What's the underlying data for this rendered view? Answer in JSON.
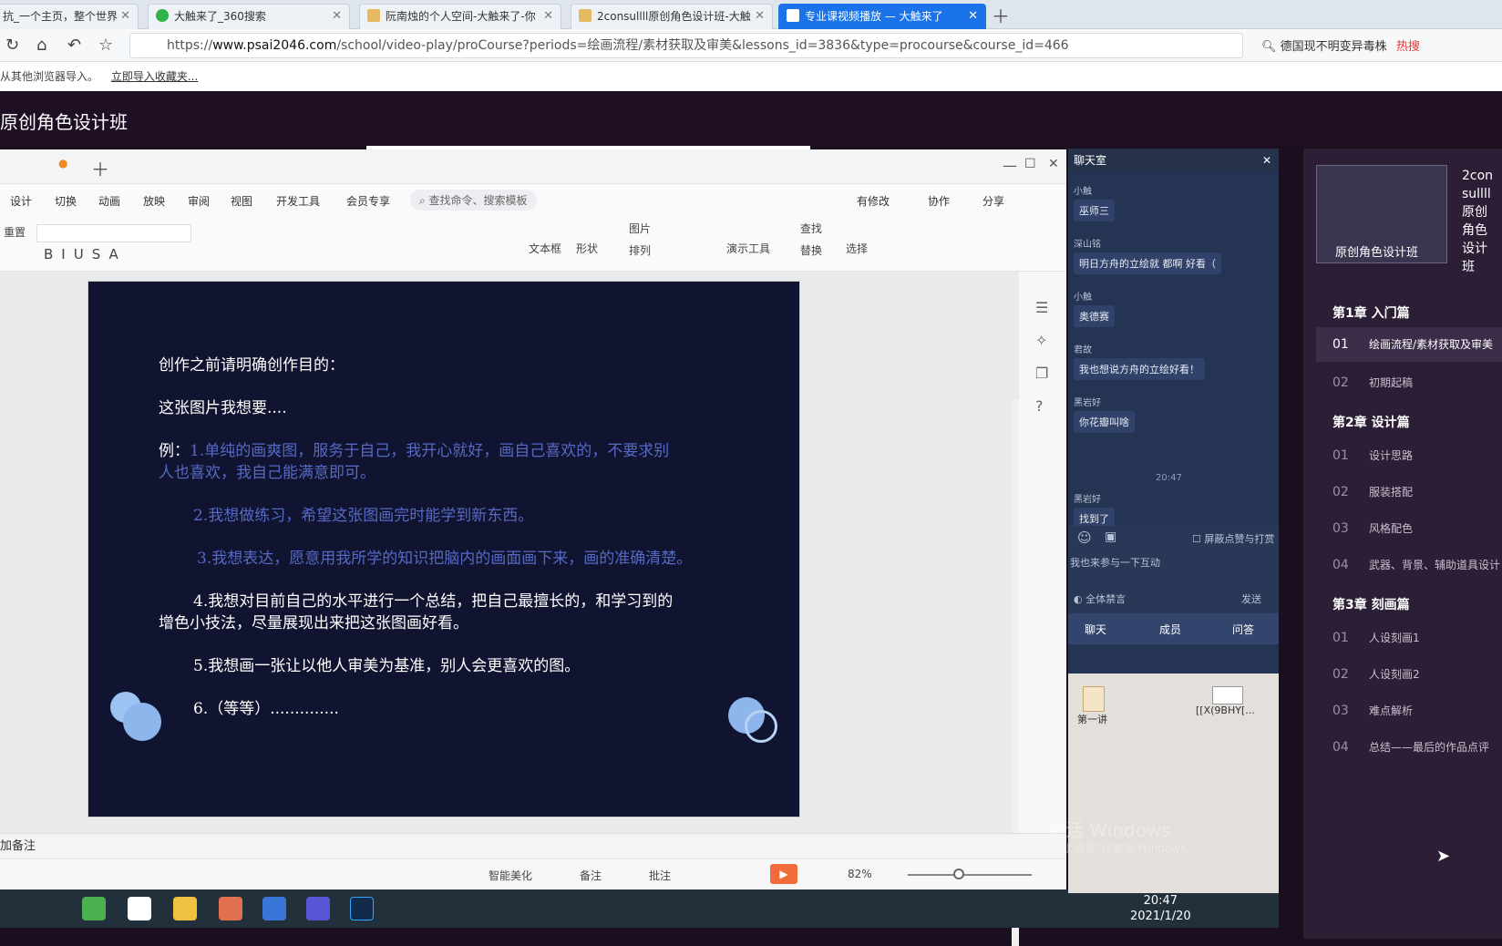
{
  "browser": {
    "tabs": [
      {
        "label": "抗_一个主页，整个世界",
        "icon_color": "#f0b400"
      },
      {
        "label": "大触来了_360搜索",
        "icon_color": "#2fb34a"
      },
      {
        "label": "阮南烛的个人空间-大触来了-你",
        "icon_color": "#e6b860"
      },
      {
        "label": "2consullll原创角色设计班-大触",
        "icon_color": "#e6b860"
      },
      {
        "label": "专业课视频播放 — 大触来了",
        "icon_color": "#ffffff"
      }
    ],
    "url_prefix": "https://",
    "url_domain": "www.psai2046.com",
    "url_rest": "/school/video-play/proCourse?periods=绘画流程/素材获取及审美&lessons_id=3836&type=procourse&course_id=466",
    "search_text": "德国现不明变异毒株",
    "search_hot": "热搜",
    "bookmark_text": "从其他浏览器导入。",
    "bookmark_link": "立即导入收藏夹..."
  },
  "site": {
    "title": "原创角色设计班"
  },
  "wps": {
    "menu": [
      "设计",
      "切换",
      "动画",
      "放映",
      "审阅",
      "视图",
      "开发工具",
      "会员专享"
    ],
    "search_placeholder": "查找命令、搜索模板",
    "right_actions": [
      "有修改",
      "协作",
      "分享"
    ],
    "toolbar_right": [
      "文本框",
      "形状",
      "图片",
      "排列",
      "演示工具",
      "查找",
      "替换",
      "选择"
    ],
    "notes_label": "加备注",
    "status": {
      "beautify": "智能美化",
      "notes": "备注",
      "comment": "批注",
      "zoom": "82%"
    }
  },
  "slide": {
    "lines": [
      {
        "text": "创作之前请明确创作目的：",
        "blue": false
      },
      {
        "text": "这张图片我想要....",
        "blue": false
      },
      {
        "prefix": "例：",
        "text": "1.单纯的画爽图，服务于自己，我开心就好，画自己喜欢的，不要求别",
        "blue": true
      },
      {
        "text": "人也喜欢，我自己能满意即可。",
        "blue": true
      },
      {
        "text": "2.我想做练习，希望这张图画完时能学到新东西。",
        "blue": true
      },
      {
        "text": "3.我想表达，愿意用我所学的知识把脑内的画面画下来，画的准确清楚。",
        "blue": true
      },
      {
        "text": "4.我想对目前自己的水平进行一个总结，把自己最擅长的，和学习到的",
        "blue": false
      },
      {
        "text": "增色小技法，尽量展现出来把这张图画好看。",
        "blue": false
      },
      {
        "text": "5.我想画一张让以他人审美为基准，别人会更喜欢的图。",
        "blue": false
      },
      {
        "text": "6.（等等）..............",
        "blue": false
      }
    ]
  },
  "taskbar": {
    "time": "20:47",
    "date": "2021/1/20"
  },
  "chat": {
    "title": "聊天室",
    "messages": [
      {
        "name": "小触",
        "text": "巫师三"
      },
      {
        "name": "深山铭",
        "text": "明日方舟的立绘就 都啊 好看（"
      },
      {
        "name": "小触",
        "text": "奥德赛"
      },
      {
        "name": "君故",
        "text": "我也想说方舟的立绘好看！"
      },
      {
        "name": "黑岩好",
        "text": "你花瓣叫啥"
      },
      {
        "name": "黑岩好",
        "text": "找到了"
      }
    ],
    "time": "20:47",
    "input_placeholder": "我也来参与一下互动",
    "block_label": "屏蔽点赞与打赏",
    "mute_label": "全体禁言",
    "send": "发送",
    "tabs": [
      "聊天",
      "成员",
      "问答"
    ],
    "desktop_labels": [
      "第一讲",
      "[[X(9BHY[..."
    ]
  },
  "course": {
    "title": "2consullll原创角色设计班",
    "thumb_label": "原创角色设计班",
    "chapters": [
      {
        "title": "第1章 入门篇",
        "lessons": [
          {
            "num": "01",
            "title": "绘画流程/素材获取及审美",
            "current": true
          },
          {
            "num": "02",
            "title": "初期起稿"
          }
        ]
      },
      {
        "title": "第2章 设计篇",
        "lessons": [
          {
            "num": "01",
            "title": "设计思路"
          },
          {
            "num": "02",
            "title": "服装搭配"
          },
          {
            "num": "03",
            "title": "风格配色"
          },
          {
            "num": "04",
            "title": "武器、背景、辅助道具设计"
          }
        ]
      },
      {
        "title": "第3章 刻画篇",
        "lessons": [
          {
            "num": "01",
            "title": "人设刻画1"
          },
          {
            "num": "02",
            "title": "人设刻画2"
          },
          {
            "num": "03",
            "title": "难点解析"
          },
          {
            "num": "04",
            "title": "总结——最后的作品点评"
          }
        ]
      }
    ]
  },
  "watermark": {
    "line1": "激活 Windows",
    "line2": "转到\"设置\"以激活 Windows。"
  }
}
